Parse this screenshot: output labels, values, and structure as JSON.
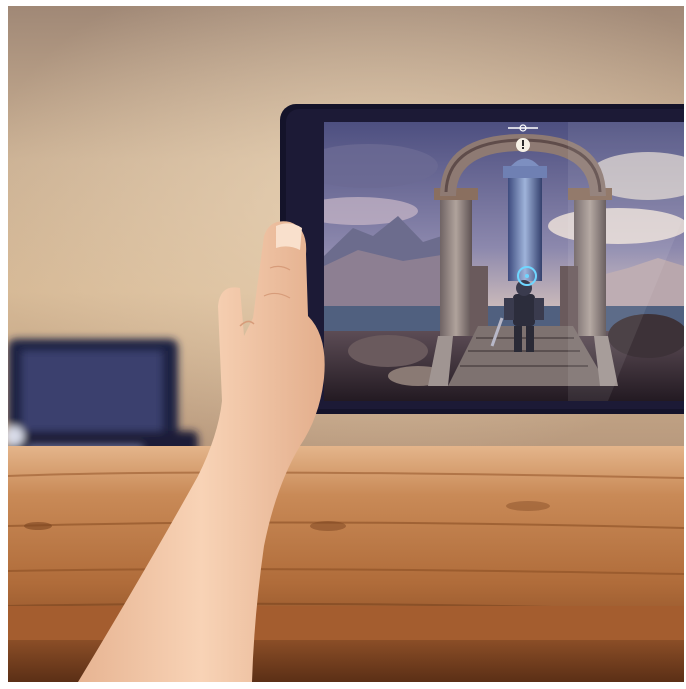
{
  "scene": {
    "description_free": true,
    "game_hud": {
      "top_emblem_icon": "sword-emblem-icon",
      "alert_icon": "exclamation-icon",
      "target_reticle_icon": "reticle-icon"
    },
    "colors": {
      "wall": "#c7a98c",
      "wall_shadow": "#9a7f68",
      "table_top": "#b5743f",
      "table_dark": "#7a4522",
      "tablet_bezel": "#16142a",
      "console_body": "#1c1f3e",
      "sky_top": "#5e5f8e",
      "sky_glow": "#e9d8c8",
      "skin": "#f2c7a6"
    }
  }
}
